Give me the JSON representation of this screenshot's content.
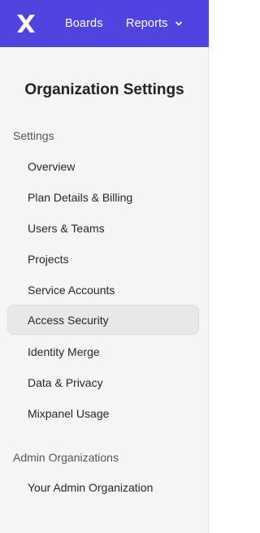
{
  "topbar": {
    "logo_icon": "mixpanel-logo-icon",
    "boards_label": "Boards",
    "reports_label": "Reports",
    "reports_chevron_icon": "chevron-down-icon",
    "background_color": "#4f44e0"
  },
  "sidebar": {
    "title": "Organization Settings",
    "settings_heading": "Settings",
    "items": [
      {
        "label": "Overview",
        "active": false
      },
      {
        "label": "Plan Details & Billing",
        "active": false
      },
      {
        "label": "Users & Teams",
        "active": false
      },
      {
        "label": "Projects",
        "active": false
      },
      {
        "label": "Service Accounts",
        "active": false
      },
      {
        "label": "Access Security",
        "active": true
      },
      {
        "label": "Identity Merge",
        "active": false
      },
      {
        "label": "Data & Privacy",
        "active": false
      },
      {
        "label": "Mixpanel Usage",
        "active": false
      }
    ],
    "admin_heading": "Admin Organizations",
    "admin_items": [
      {
        "label": "Your Admin Organization",
        "active": false
      }
    ]
  }
}
